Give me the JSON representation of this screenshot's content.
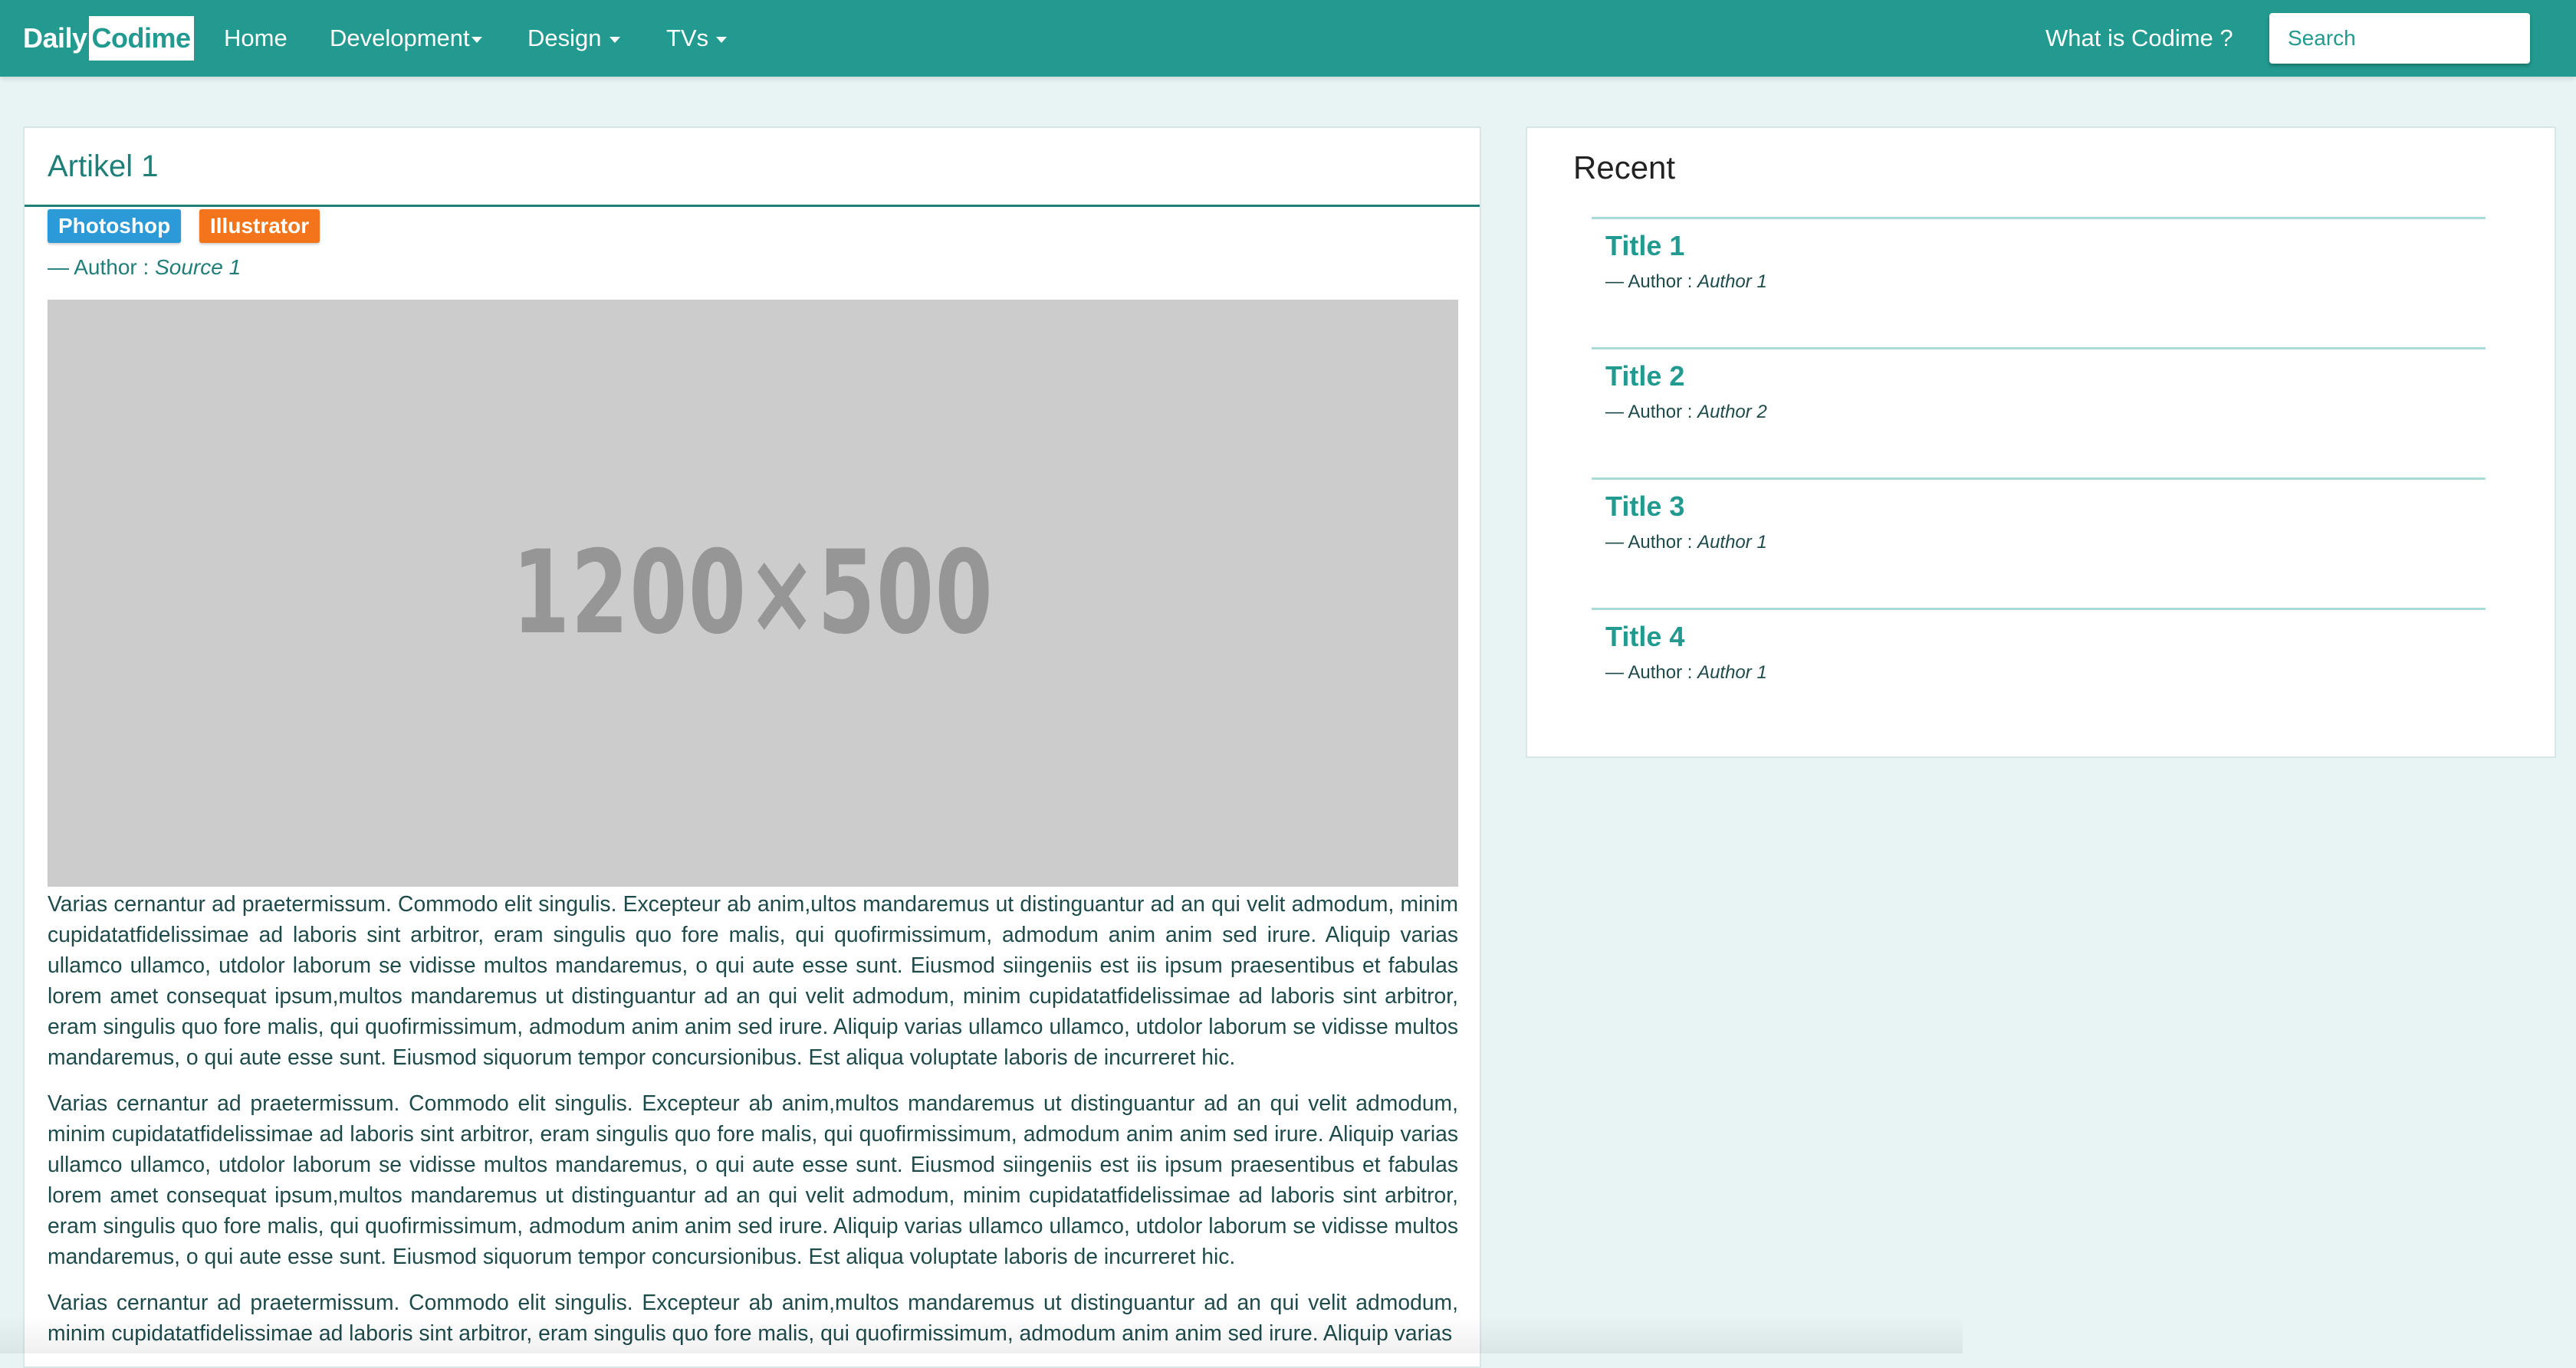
{
  "navbar": {
    "brand_part1": "Daily",
    "brand_part2": "Codime",
    "items": [
      {
        "label": "Home"
      },
      {
        "label": "Development"
      },
      {
        "label": "Design"
      },
      {
        "label": "TVs"
      }
    ],
    "about_label": "What is Codime ?",
    "search_placeholder": "Search"
  },
  "article": {
    "title": "Artikel 1",
    "tags": [
      "Photoshop",
      "Illustrator"
    ],
    "author_prefix": "— Author : ",
    "author_source": "Source 1",
    "image_placeholder": "1200×500",
    "paragraphs": [
      "Varias cernantur ad praetermissum. Commodo elit singulis. Excepteur ab anim,ultos mandaremus ut distinguantur ad an qui velit admodum, minim cupidatatfidelissimae ad laboris sint arbitror, eram singulis quo fore malis, qui quofirmissimum, admodum anim anim sed irure. Aliquip varias ullamco ullamco, utdolor laborum se vidisse multos mandaremus, o qui aute esse sunt. Eiusmod siingeniis est iis ipsum praesentibus et fabulas lorem amet consequat ipsum,multos mandaremus ut distinguantur ad an qui velit admodum, minim cupidatatfidelissimae ad laboris sint arbitror, eram singulis quo fore malis, qui quofirmissimum, admodum anim anim sed irure. Aliquip varias ullamco ullamco, utdolor laborum se vidisse multos mandaremus, o qui aute esse sunt. Eiusmod siquorum tempor concursionibus. Est aliqua voluptate laboris de incurreret hic.",
      "Varias cernantur ad praetermissum. Commodo elit singulis. Excepteur ab anim,multos mandaremus ut distinguantur ad an qui velit admodum, minim cupidatatfidelissimae ad laboris sint arbitror, eram singulis quo fore malis, qui quofirmissimum, admodum anim anim sed irure. Aliquip varias ullamco ullamco, utdolor laborum se vidisse multos mandaremus, o qui aute esse sunt. Eiusmod siingeniis est iis ipsum praesentibus et fabulas lorem amet consequat ipsum,multos mandaremus ut distinguantur ad an qui velit admodum, minim cupidatatfidelissimae ad laboris sint arbitror, eram singulis quo fore malis, qui quofirmissimum, admodum anim anim sed irure. Aliquip varias ullamco ullamco, utdolor laborum se vidisse multos mandaremus, o qui aute esse sunt. Eiusmod siquorum tempor concursionibus. Est aliqua voluptate laboris de incurreret hic.",
      "Varias cernantur ad praetermissum. Commodo elit singulis. Excepteur ab anim,multos mandaremus ut distinguantur ad an qui velit admodum, minim cupidatatfidelissimae ad laboris sint arbitror, eram singulis quo fore malis, qui quofirmissimum, admodum anim anim sed irure. Aliquip varias"
    ]
  },
  "sidebar": {
    "title": "Recent",
    "items": [
      {
        "title": "Title 1",
        "author_prefix": "— Author : ",
        "author": "Author 1"
      },
      {
        "title": "Title 2",
        "author_prefix": "— Author : ",
        "author": "Author 2"
      },
      {
        "title": "Title 3",
        "author_prefix": "— Author : ",
        "author": "Author 1"
      },
      {
        "title": "Title 4",
        "author_prefix": "— Author : ",
        "author": "Author 1"
      }
    ]
  },
  "colors": {
    "primary": "#229a8f",
    "dark_teal": "#1f7f78",
    "page_bg": "#e8f4f4",
    "tag_photoshop": "#2d9ad8",
    "tag_illustrator": "#f3741b",
    "image_placeholder_bg": "#cccccc"
  }
}
